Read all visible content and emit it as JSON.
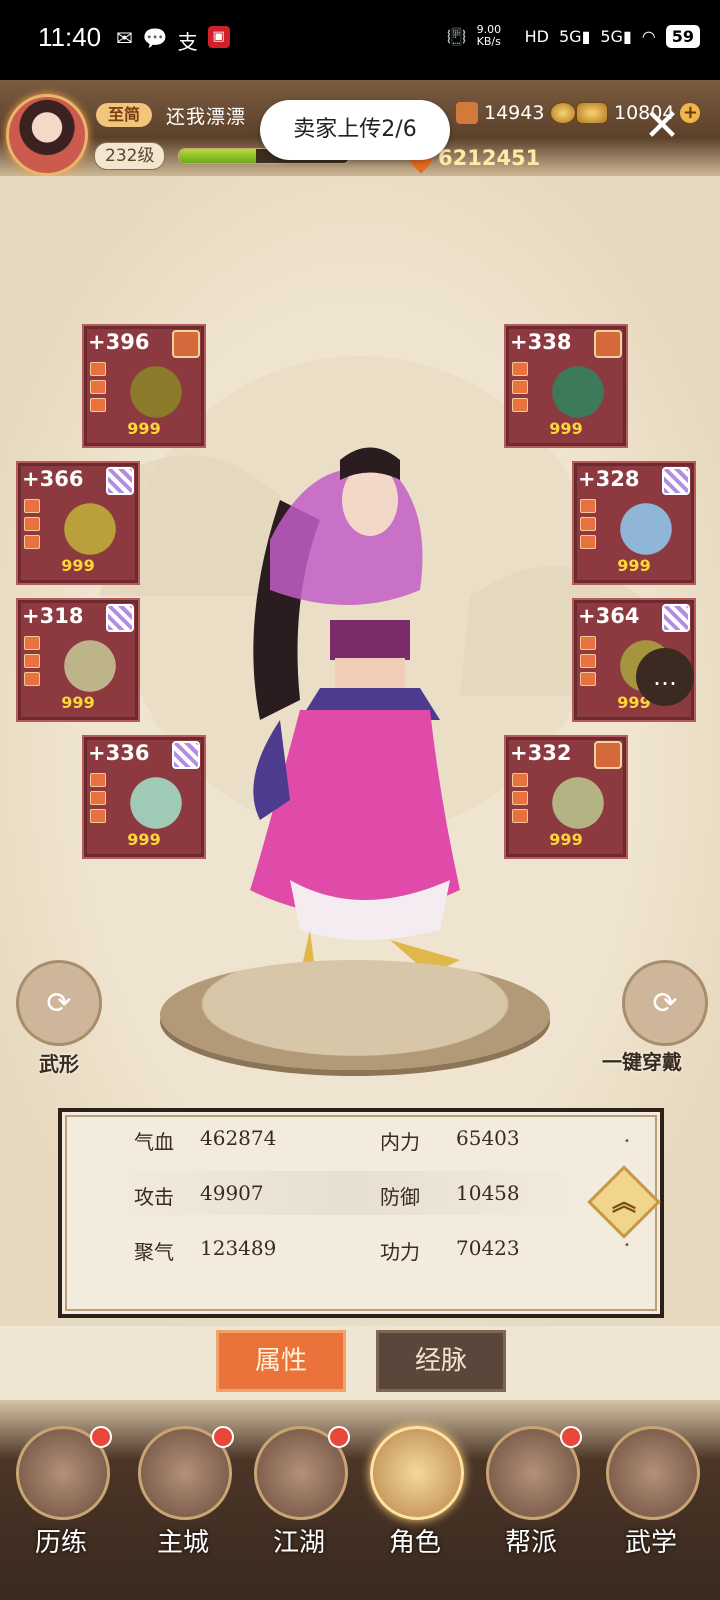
{
  "status_bar": {
    "time": "11:40",
    "left_icons": [
      "message-icon",
      "chat-icon",
      "pay-icon",
      "app-icon"
    ],
    "speed": "9.00 KB/s",
    "battery": "59"
  },
  "player": {
    "rank": "至简",
    "name": "还我漂漂",
    "level": "232级",
    "exp_fraction": 0.45
  },
  "currency": {
    "jade": "14943",
    "gold": "10804",
    "power": "6212451"
  },
  "toast": "卖家上传2/6",
  "equipment": [
    {
      "slot": "weapon",
      "plus": "+396",
      "quality": "gold",
      "count": "999",
      "art_color": "#8a7a2a"
    },
    {
      "slot": "necklace",
      "plus": "+338",
      "quality": "gold",
      "count": "999",
      "art_color": "#3c7a5a"
    },
    {
      "slot": "armor",
      "plus": "+366",
      "quality": "purple",
      "count": "999",
      "art_color": "#b9a03a"
    },
    {
      "slot": "hidden-weapon",
      "plus": "+328",
      "quality": "purple",
      "count": "999",
      "art_color": "#8fb6d6"
    },
    {
      "slot": "belt",
      "plus": "+318",
      "quality": "purple",
      "count": "999",
      "art_color": "#bdb48a"
    },
    {
      "slot": "bracer",
      "plus": "+364",
      "quality": "purple",
      "count": "999",
      "art_color": "#a7943e"
    },
    {
      "slot": "boots",
      "plus": "+336",
      "quality": "purple",
      "count": "999",
      "art_color": "#9fcab6"
    },
    {
      "slot": "ring",
      "plus": "+332",
      "quality": "gold",
      "count": "999",
      "art_color": "#b3b384"
    }
  ],
  "buttons": {
    "martial_form": "武形",
    "one_key_equip": "一键穿戴"
  },
  "stats": [
    {
      "label": "气血",
      "value": "462874",
      "label2": "内力",
      "value2": "65403"
    },
    {
      "label": "攻击",
      "value": "49907",
      "label2": "防御",
      "value2": "10458"
    },
    {
      "label": "聚气",
      "value": "123489",
      "label2": "功力",
      "value2": "70423"
    }
  ],
  "tabs": [
    "属性",
    "经脉"
  ],
  "nav": [
    {
      "label": "历练",
      "icon": "adventure-icon"
    },
    {
      "label": "主城",
      "icon": "city-icon"
    },
    {
      "label": "江湖",
      "icon": "jianghu-icon"
    },
    {
      "label": "角色",
      "icon": "character-icon"
    },
    {
      "label": "帮派",
      "icon": "guild-icon"
    },
    {
      "label": "武学",
      "icon": "martial-arts-icon"
    }
  ]
}
